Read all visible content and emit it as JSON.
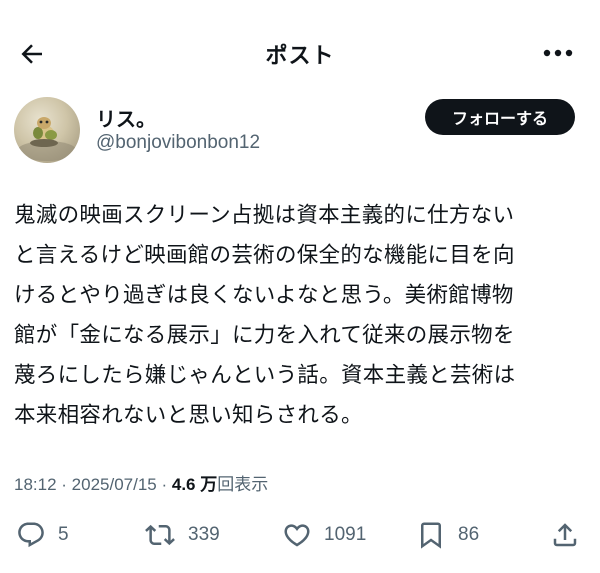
{
  "header": {
    "title": "ポスト"
  },
  "author": {
    "display_name": "リス。",
    "handle": "@bonjovibonbon12"
  },
  "follow_button": {
    "label": "フォローする"
  },
  "tweet": {
    "lines": [
      "鬼滅の映画スクリーン占拠は資本主義的に仕方ない",
      "と言えるけど映画館の芸術の保全的な機能に目を向",
      "けるとやり過ぎは良くないよなと思う。美術館博物",
      "館が「金になる展示」に力を入れて従来の展示物を",
      "蔑ろにしたら嫌じゃんという話。資本主義と芸術は",
      "本来相容れないと思い知らされる。"
    ]
  },
  "meta": {
    "time": "18:12",
    "separator": " · ",
    "date": "2025/07/15",
    "views_count": "4.6 万",
    "views_label": "回表示"
  },
  "actions": {
    "replies": "5",
    "reposts": "339",
    "likes": "1091",
    "bookmarks": "86"
  },
  "icons": {
    "back": "arrow-left-icon",
    "more": "more-dots-icon",
    "reply": "reply-icon",
    "repost": "repost-icon",
    "like": "heart-icon",
    "bookmark": "bookmark-icon",
    "share": "share-icon"
  },
  "colors": {
    "text": "#0f1419",
    "secondary": "#536471",
    "button_bg": "#0f1419",
    "button_text": "#ffffff"
  }
}
